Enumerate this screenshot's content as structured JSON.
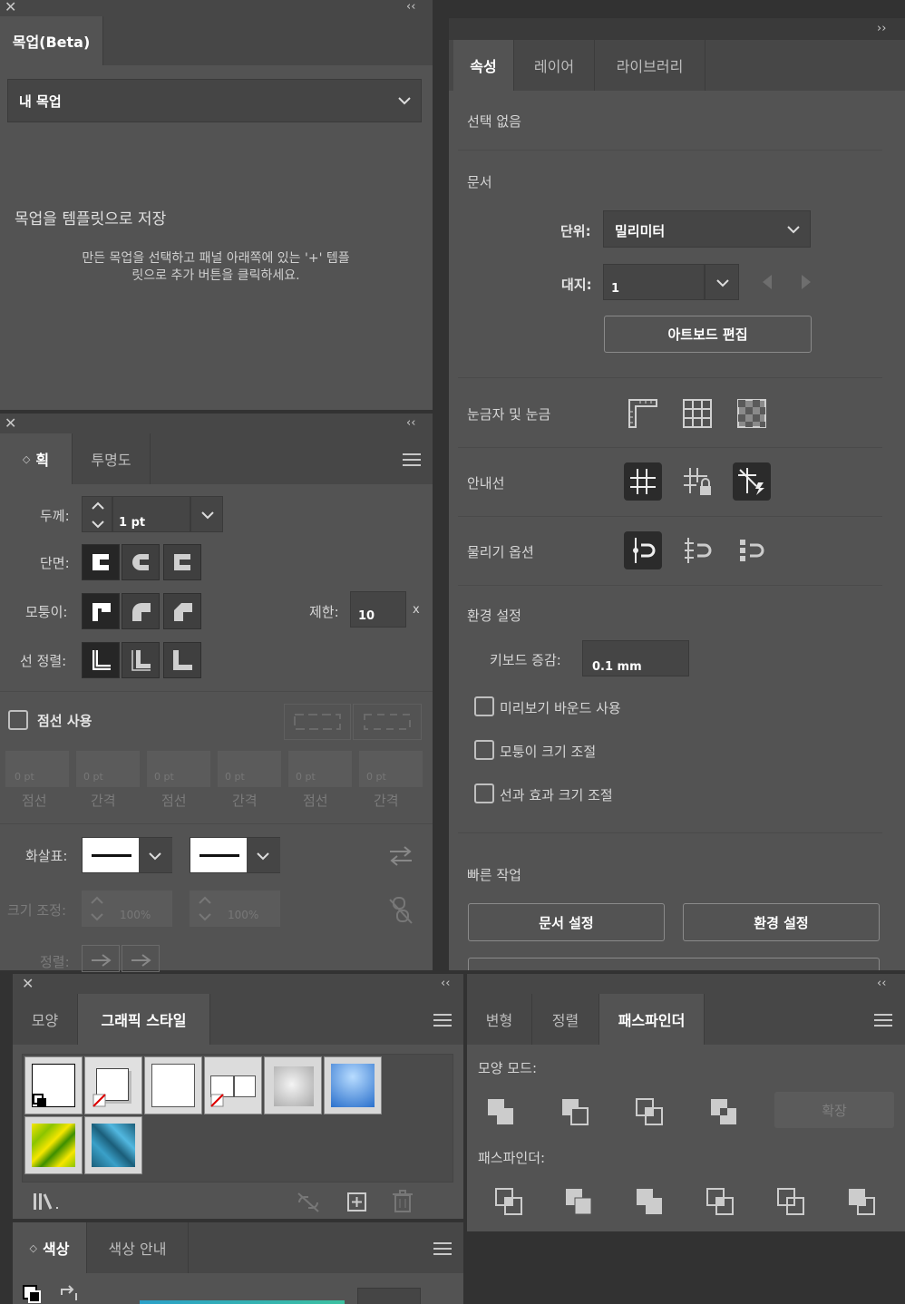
{
  "mockup_panel": {
    "tab": "목업(Beta)",
    "dropdown_value": "내 목업",
    "heading": "목업을 템플릿으로 저장",
    "description": "만든 목업을 선택하고 패널 아래쪽에 있는 '+' 템플릿으로 추가 버튼을 클릭하세요."
  },
  "stroke_panel": {
    "tabs": [
      "획",
      "투명도"
    ],
    "weight_label": "두께:",
    "weight_value": "1 pt",
    "cap_label": "단면:",
    "corner_label": "모퉁이:",
    "limit_label": "제한:",
    "limit_value": "10",
    "limit_unit": "x",
    "align_label": "선 정렬:",
    "dashed_label": "점선 사용",
    "dash_fields": [
      {
        "value": "0 pt",
        "label": "점선"
      },
      {
        "value": "0 pt",
        "label": "간격"
      },
      {
        "value": "0 pt",
        "label": "점선"
      },
      {
        "value": "0 pt",
        "label": "간격"
      },
      {
        "value": "0 pt",
        "label": "점선"
      },
      {
        "value": "0 pt",
        "label": "간격"
      }
    ],
    "arrowheads_label": "화살표:",
    "scale_label": "크기 조정:",
    "scale_start": "100%",
    "scale_end": "100%",
    "align_arrow_label": "정렬:"
  },
  "properties_panel": {
    "tabs": [
      "속성",
      "레이어",
      "라이브러리"
    ],
    "no_selection": "선택 없음",
    "document_section": "문서",
    "units_label": "단위:",
    "units_value": "밀리미터",
    "artboard_label": "대지:",
    "artboard_value": "1",
    "edit_artboards_button": "아트보드 편집",
    "rulers_grids_label": "눈금자 및 눈금",
    "guides_label": "안내선",
    "snap_options_label": "물리기 옵션",
    "preferences_section": "환경 설정",
    "keyboard_increment_label": "키보드 증감:",
    "keyboard_increment_value": "0.1 mm",
    "checkboxes": [
      "미리보기 바운드 사용",
      "모퉁이 크기 조절",
      "선과 효과 크기 조절"
    ],
    "quick_actions_section": "빠른 작업",
    "doc_setup_button": "문서 설정",
    "preferences_button": "환경 설정"
  },
  "graphic_styles_panel": {
    "tabs": [
      "모양",
      "그래픽 스타일"
    ]
  },
  "color_panel": {
    "tabs": [
      "색상",
      "색상 안내"
    ]
  },
  "pathfinder_panel": {
    "tabs": [
      "변형",
      "정렬",
      "패스파인더"
    ],
    "shape_modes_label": "모양 모드:",
    "expand_button": "확장",
    "pathfinders_label": "패스파인더:"
  },
  "colors": {
    "panel_bg": "#535353",
    "app_bg": "#323232",
    "tab_bar_bg": "#474747",
    "text": "#d6d6d6"
  }
}
